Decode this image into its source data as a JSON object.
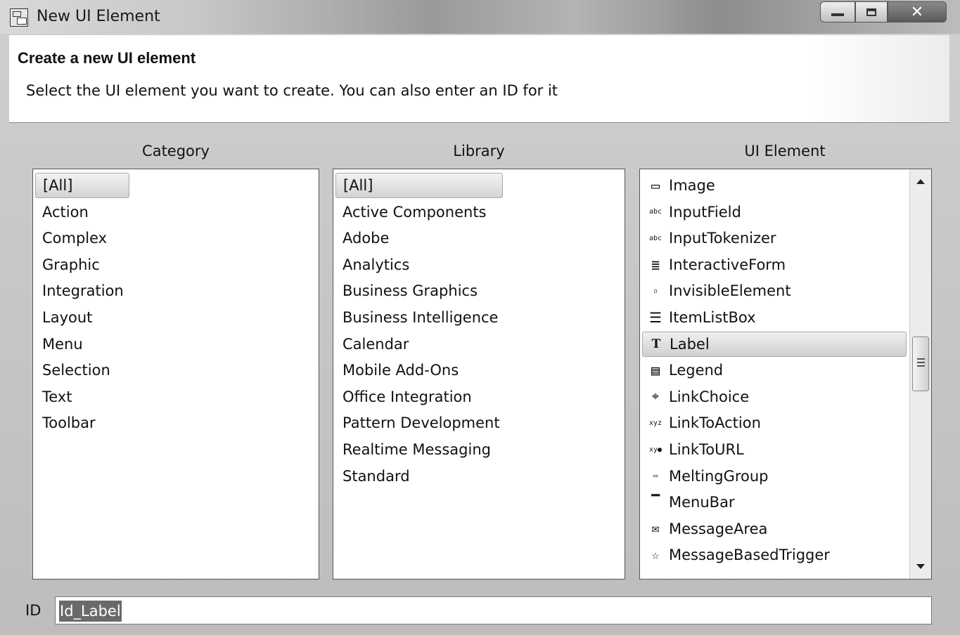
{
  "window": {
    "title": "New UI Element",
    "title_icon": "dialog-icon"
  },
  "header": {
    "title": "Create a new UI element",
    "description": "Select the UI element you want to create. You can also enter an ID for it"
  },
  "category": {
    "heading": "Category",
    "items": [
      "[All]",
      "Action",
      "Complex",
      "Graphic",
      "Integration",
      "Layout",
      "Menu",
      "Selection",
      "Text",
      "Toolbar"
    ],
    "selected": "[All]"
  },
  "library": {
    "heading": "Library",
    "items": [
      "[All]",
      "Active Components",
      "Adobe",
      "Analytics",
      "Business Graphics",
      "Business Intelligence",
      "Calendar",
      "Mobile Add-Ons",
      "Office Integration",
      "Pattern Development",
      "Realtime Messaging",
      "Standard"
    ],
    "selected": "[All]"
  },
  "ui_element": {
    "heading": "UI Element",
    "items": [
      {
        "label": "Image",
        "icon": "image-icon"
      },
      {
        "label": "InputField",
        "icon": "input-field-icon"
      },
      {
        "label": "InputTokenizer",
        "icon": "input-tokenizer-icon"
      },
      {
        "label": "InteractiveForm",
        "icon": "form-icon"
      },
      {
        "label": "InvisibleElement",
        "icon": "invisible-element-icon"
      },
      {
        "label": "ItemListBox",
        "icon": "list-box-icon"
      },
      {
        "label": "Label",
        "icon": "label-icon"
      },
      {
        "label": "Legend",
        "icon": "legend-icon"
      },
      {
        "label": "LinkChoice",
        "icon": "link-choice-icon"
      },
      {
        "label": "LinkToAction",
        "icon": "link-to-action-icon"
      },
      {
        "label": "LinkToURL",
        "icon": "link-to-url-icon"
      },
      {
        "label": "MeltingGroup",
        "icon": "melting-group-icon"
      },
      {
        "label": "MenuBar",
        "icon": "menu-bar-icon"
      },
      {
        "label": "MessageArea",
        "icon": "message-area-icon"
      },
      {
        "label": "MessageBasedTrigger",
        "icon": "message-trigger-icon"
      }
    ],
    "selected": "Label"
  },
  "id_field": {
    "label": "ID",
    "value": "Id_Label"
  }
}
